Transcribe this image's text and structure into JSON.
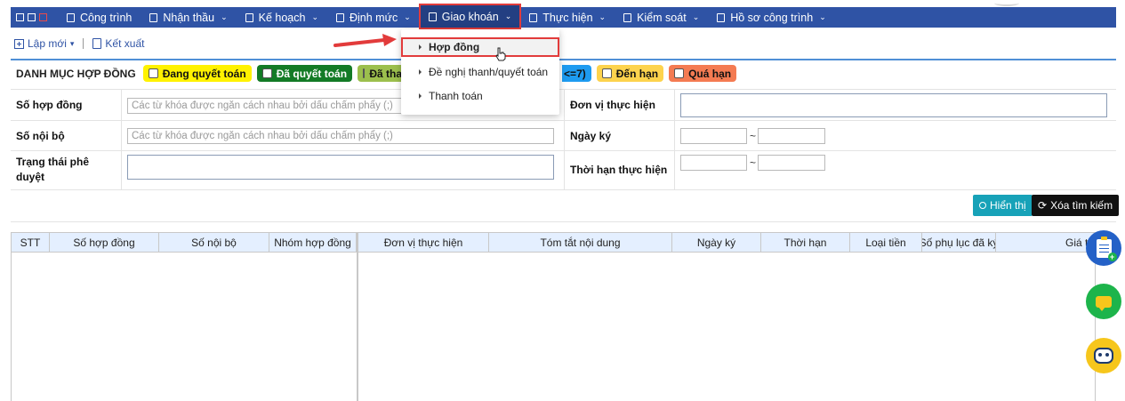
{
  "nav": {
    "items": [
      {
        "label": "Công trình",
        "icon": "building-icon"
      },
      {
        "label": "Nhận thầu",
        "icon": "document-icon"
      },
      {
        "label": "Kế hoạch",
        "icon": "calendar-icon"
      },
      {
        "label": "Định mức",
        "icon": "document-icon"
      },
      {
        "label": "Giao khoán",
        "icon": "document-icon"
      },
      {
        "label": "Thực hiện",
        "icon": "checkbox-icon"
      },
      {
        "label": "Kiểm soát",
        "icon": "monitor-icon"
      },
      {
        "label": "Hồ sơ công trình",
        "icon": "briefcase-icon"
      }
    ]
  },
  "toolbar": {
    "new_label": "Lập mới",
    "export_label": "Kết xuất"
  },
  "legend": {
    "title": "DANH MỤC HỢP ĐỒNG",
    "items": [
      {
        "label": "Đang quyết toán",
        "color": "#fff200"
      },
      {
        "label": "Đã quyết toán",
        "color": "#137b26"
      },
      {
        "label": "Đã tha",
        "color": "#9cbf4d"
      },
      {
        "label": "<=7)",
        "color": "#1e9bf0"
      },
      {
        "label": "Đến hạn",
        "color": "#fdd34d"
      },
      {
        "label": "Quá hạn",
        "color": "#f47b52"
      }
    ]
  },
  "form": {
    "contract_no_label": "Số hợp đồng",
    "contract_no_placeholder": "Các từ khóa được ngăn cách nhau bởi dấu chấm phẩy (;)",
    "internal_no_label": "Số nội bộ",
    "internal_no_placeholder": "Các từ khóa được ngăn cách nhau bởi dấu chấm phẩy (;)",
    "approval_label_1": "Trạng thái phê",
    "approval_label_2": "duyệt",
    "unit_label": "Đơn vị thực hiện",
    "sign_date_label": "Ngày ký",
    "deadline_label": "Thời hạn thực hiện",
    "range_sep": "~"
  },
  "buttons": {
    "show_label": "Hiển thị",
    "clear_label": "Xóa tìm kiếm"
  },
  "grid": {
    "columns": [
      "STT",
      "Số hợp đồng",
      "Số nội bộ",
      "Nhóm hợp đồng",
      "Đơn vị thực hiện",
      "Tóm tắt nội dung",
      "Ngày ký",
      "Thời hạn",
      "Loại tiền",
      "Số phụ lục đã ký",
      "Giá trị"
    ]
  },
  "dropdown": {
    "items": [
      {
        "label": "Hợp đồng"
      },
      {
        "label": "Đề nghị thanh/quyết toán"
      },
      {
        "label": "Thanh toán"
      }
    ]
  },
  "colors": {
    "nav_bg": "#2f53a5",
    "accent_red": "#e23b3b",
    "header_bg": "#e4efff"
  }
}
